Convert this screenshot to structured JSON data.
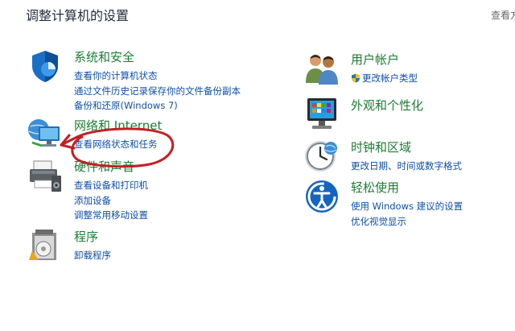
{
  "header": {
    "title": "调整计算机的设置",
    "view_by": "查看方"
  },
  "categories": [
    {
      "key": "system-security",
      "icon": "shield-icon",
      "title": "系统和安全",
      "links": [
        "查看你的计算机状态",
        "通过文件历史记录保存你的文件备份副本",
        "备份和还原(Windows 7)"
      ]
    },
    {
      "key": "network-internet",
      "icon": "network-icon",
      "title": "网络和 Internet",
      "links": [
        "查看网络状态和任务"
      ]
    },
    {
      "key": "hardware-sound",
      "icon": "printer-icon",
      "title": "硬件和声音",
      "links": [
        "查看设备和打印机",
        "添加设备",
        "调整常用移动设置"
      ]
    },
    {
      "key": "programs",
      "icon": "programs-icon",
      "title": "程序",
      "links": [
        "卸载程序"
      ]
    },
    {
      "key": "user-accounts",
      "icon": "users-icon",
      "title": "用户帐户",
      "links": [
        "更改帐户类型"
      ]
    },
    {
      "key": "appearance",
      "icon": "monitor-icon",
      "title": "外观和个性化",
      "links": []
    },
    {
      "key": "clock-region",
      "icon": "clock-icon",
      "title": "时钟和区域",
      "links": [
        "更改日期、时间或数字格式"
      ]
    },
    {
      "key": "ease-of-access",
      "icon": "ease-of-access-icon",
      "title": "轻松使用",
      "links": [
        "使用 Windows 建议的设置",
        "优化视觉显示"
      ]
    }
  ],
  "colors": {
    "category_title": "#1c7d31",
    "link": "#0f4fa8",
    "annotation": "#c41e24"
  }
}
